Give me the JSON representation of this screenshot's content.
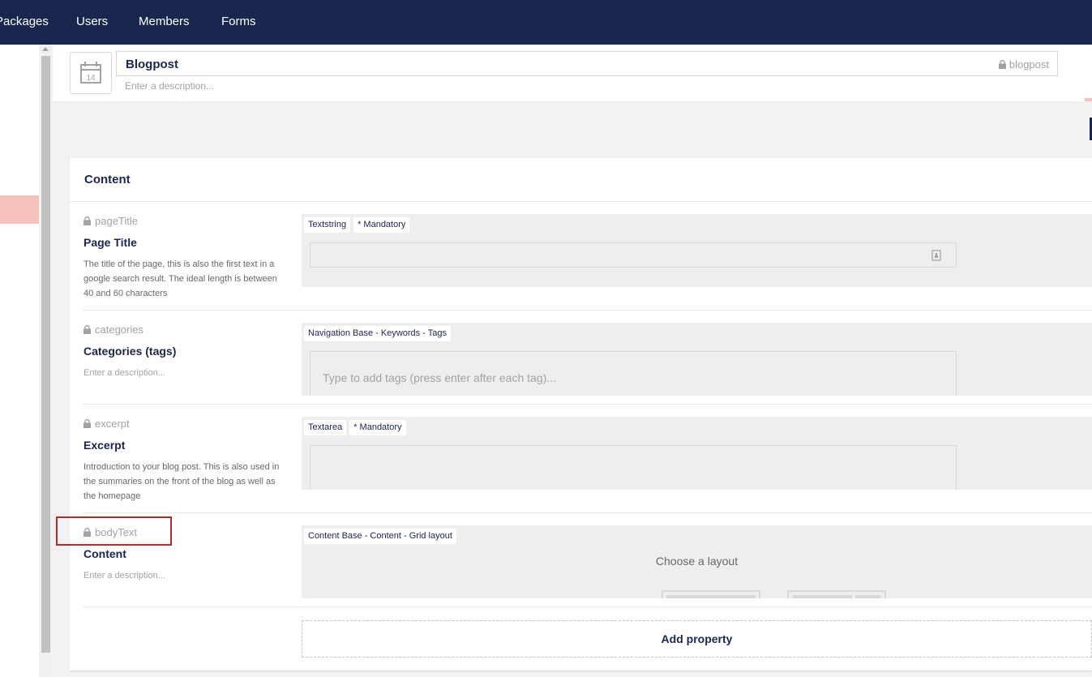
{
  "nav": {
    "items": [
      "Packages",
      "Users",
      "Members",
      "Forms"
    ]
  },
  "header": {
    "doc_type_name": "Blogpost",
    "alias": "blogpost",
    "description_placeholder": "Enter a description...",
    "icon": "calendar-icon",
    "icon_day": "14"
  },
  "group": {
    "title": "Content",
    "properties": [
      {
        "alias": "pageTitle",
        "label": "Page Title",
        "description": "The title of the page, this is also the first text in a google search result. The ideal length is between 40 and 60 characters",
        "tags": [
          "Textstring",
          "* Mandatory"
        ]
      },
      {
        "alias": "categories",
        "label": "Categories (tags)",
        "description": "Enter a description...",
        "tags": [
          "Navigation Base - Keywords - Tags"
        ],
        "input_placeholder": "Type to add tags (press enter after each tag)..."
      },
      {
        "alias": "excerpt",
        "label": "Excerpt",
        "description": "Introduction to your blog post. This is also used in the summaries on the front of the blog as well as the homepage",
        "tags": [
          "Textarea",
          "* Mandatory"
        ]
      },
      {
        "alias": "bodyText",
        "label": "Content",
        "description": "Enter a description...",
        "tags": [
          "Content Base - Content - Grid layout"
        ],
        "choose_layout": "Choose a layout"
      }
    ],
    "add_property_label": "Add property"
  },
  "colors": {
    "nav_bg": "#1b264f",
    "highlight": "#f5c1bc",
    "focus_outline": "#b52a2a"
  }
}
